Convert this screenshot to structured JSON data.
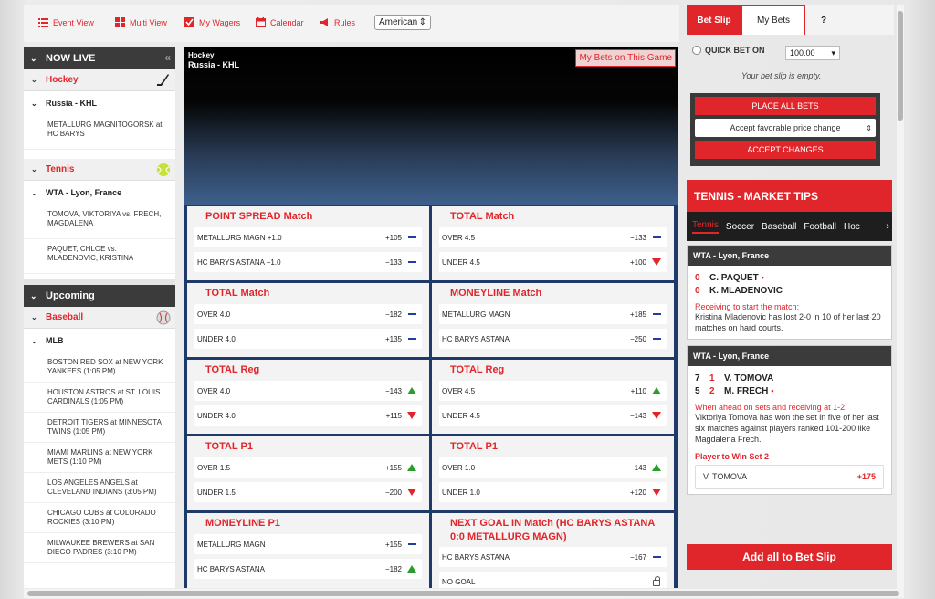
{
  "nav": {
    "items": [
      {
        "label": "Event View",
        "icon": "list-icon"
      },
      {
        "label": "Multi View",
        "icon": "grid-icon"
      },
      {
        "label": "My Wagers",
        "icon": "checkbox-icon"
      },
      {
        "label": "Calendar",
        "icon": "calendar-icon"
      },
      {
        "label": "Rules",
        "icon": "megaphone-icon"
      }
    ],
    "odds_format": "American"
  },
  "sidebar": {
    "now_live": "NOW LIVE",
    "upcoming": "Upcoming",
    "live": [
      {
        "sport": "Hockey",
        "league": "Russia - KHL",
        "events": [
          "METALLURG MAGNITOGORSK at HC BARYS"
        ]
      },
      {
        "sport": "Tennis",
        "league": "WTA - Lyon, France",
        "events": [
          "TOMOVA, VIKTORIYA vs. FRECH, MAGDALENA",
          "PAQUET, CHLOE vs. MLADENOVIC, KRISTINA"
        ]
      }
    ],
    "upcoming_sport": {
      "sport": "Baseball",
      "league": "MLB",
      "events": [
        "BOSTON RED SOX at NEW YORK YANKEES (1:05 PM)",
        "HOUSTON ASTROS at ST. LOUIS CARDINALS (1:05 PM)",
        "DETROIT TIGERS at MINNESOTA TWINS (1:05 PM)",
        "MIAMI MARLINS at NEW YORK METS (1:10 PM)",
        "LOS ANGELES ANGELS at CLEVELAND INDIANS (3:05 PM)",
        "CHICAGO CUBS at COLORADO ROCKIES (3:10 PM)",
        "MILWAUKEE BREWERS at SAN DIEGO PADRES (3:10 PM)"
      ]
    }
  },
  "stage": {
    "sport": "Hockey",
    "league": "Russia - KHL",
    "my_bets_button": "My Bets on This Game"
  },
  "markets": [
    {
      "title": "POINT SPREAD Match",
      "rows": [
        {
          "label": "METALLURG MAGN +1.0",
          "price": "+105",
          "trend": "flat"
        },
        {
          "label": "HC BARYS ASTANA −1.0",
          "price": "−133",
          "trend": "flat"
        }
      ]
    },
    {
      "title": "TOTAL Match",
      "rows": [
        {
          "label": "OVER 4.5",
          "price": "−133",
          "trend": "flat"
        },
        {
          "label": "UNDER 4.5",
          "price": "+100",
          "trend": "down"
        }
      ]
    },
    {
      "title": "TOTAL Match",
      "rows": [
        {
          "label": "OVER 4.0",
          "price": "−182",
          "trend": "flat"
        },
        {
          "label": "UNDER 4.0",
          "price": "+135",
          "trend": "flat"
        }
      ]
    },
    {
      "title": "MONEYLINE Match",
      "rows": [
        {
          "label": "METALLURG MAGN",
          "price": "+185",
          "trend": "flat"
        },
        {
          "label": "HC BARYS ASTANA",
          "price": "−250",
          "trend": "flat"
        }
      ]
    },
    {
      "title": "TOTAL Reg",
      "rows": [
        {
          "label": "OVER 4.0",
          "price": "−143",
          "trend": "up"
        },
        {
          "label": "UNDER 4.0",
          "price": "+115",
          "trend": "down"
        }
      ]
    },
    {
      "title": "TOTAL Reg",
      "rows": [
        {
          "label": "OVER 4.5",
          "price": "+110",
          "trend": "up"
        },
        {
          "label": "UNDER 4.5",
          "price": "−143",
          "trend": "down"
        }
      ]
    },
    {
      "title": "TOTAL P1",
      "rows": [
        {
          "label": "OVER 1.5",
          "price": "+155",
          "trend": "up"
        },
        {
          "label": "UNDER 1.5",
          "price": "−200",
          "trend": "down"
        }
      ]
    },
    {
      "title": "TOTAL P1",
      "rows": [
        {
          "label": "OVER 1.0",
          "price": "−143",
          "trend": "up"
        },
        {
          "label": "UNDER 1.0",
          "price": "+120",
          "trend": "down"
        }
      ]
    },
    {
      "title": "MONEYLINE P1",
      "rows": [
        {
          "label": "METALLURG MAGN",
          "price": "+155",
          "trend": "flat"
        },
        {
          "label": "HC BARYS ASTANA",
          "price": "−182",
          "trend": "up"
        }
      ]
    },
    {
      "title": "NEXT GOAL IN Match (HC BARYS ASTANA 0:0 METALLURG MAGN)",
      "rows": [
        {
          "label": "HC BARYS ASTANA",
          "price": "−167",
          "trend": "flat"
        },
        {
          "label": "NO GOAL",
          "price": "",
          "trend": "lock"
        }
      ]
    }
  ],
  "betslip": {
    "tab_active": "Bet Slip",
    "tab_mybets": "My Bets",
    "tab_help": "?",
    "quick_bet_label": "QUICK BET ON",
    "quick_bet_amount": "100.00",
    "empty_msg": "Your bet slip is empty.",
    "place_all": "PLACE ALL BETS",
    "price_change_option": "Accept favorable price change",
    "accept_changes": "ACCEPT CHANGES"
  },
  "tips": {
    "header": "TENNIS - MARKET TIPS",
    "sport_tabs": [
      "Tennis",
      "Soccer",
      "Baseball",
      "Football",
      "Hoc"
    ],
    "card1": {
      "league": "WTA - Lyon, France",
      "players": [
        {
          "sets": "",
          "games": "0",
          "name": "C. PAQUET",
          "serving": true
        },
        {
          "sets": "",
          "games": "0",
          "name": "K. MLADENOVIC",
          "serving": false
        }
      ],
      "tip_title": "Receiving to start the match:",
      "tip_text": "Kristina Mladenovic has lost 2-0 in 10 of her last 20 matches on hard courts."
    },
    "card2": {
      "league": "WTA - Lyon, France",
      "players": [
        {
          "sets": "7",
          "games": "1",
          "name": "V. TOMOVA",
          "serving": false
        },
        {
          "sets": "5",
          "games": "2",
          "name": "M. FRECH",
          "serving": true
        }
      ],
      "tip_title": "When ahead on sets and receiving at 1-2:",
      "tip_text": "Viktoriya Tomova has won the set in five of her last six matches against players ranked 101-200 like Magdalena Frech.",
      "wager_title": "Player to Win Set 2",
      "wager_name": "V. TOMOVA",
      "wager_odds": "+175"
    },
    "add_all": "Add all to Bet Slip"
  },
  "colors": {
    "accent": "#e0262b",
    "dark": "#3b3b3b",
    "up": "#2a9d2a",
    "flat": "#1f3fa0"
  }
}
